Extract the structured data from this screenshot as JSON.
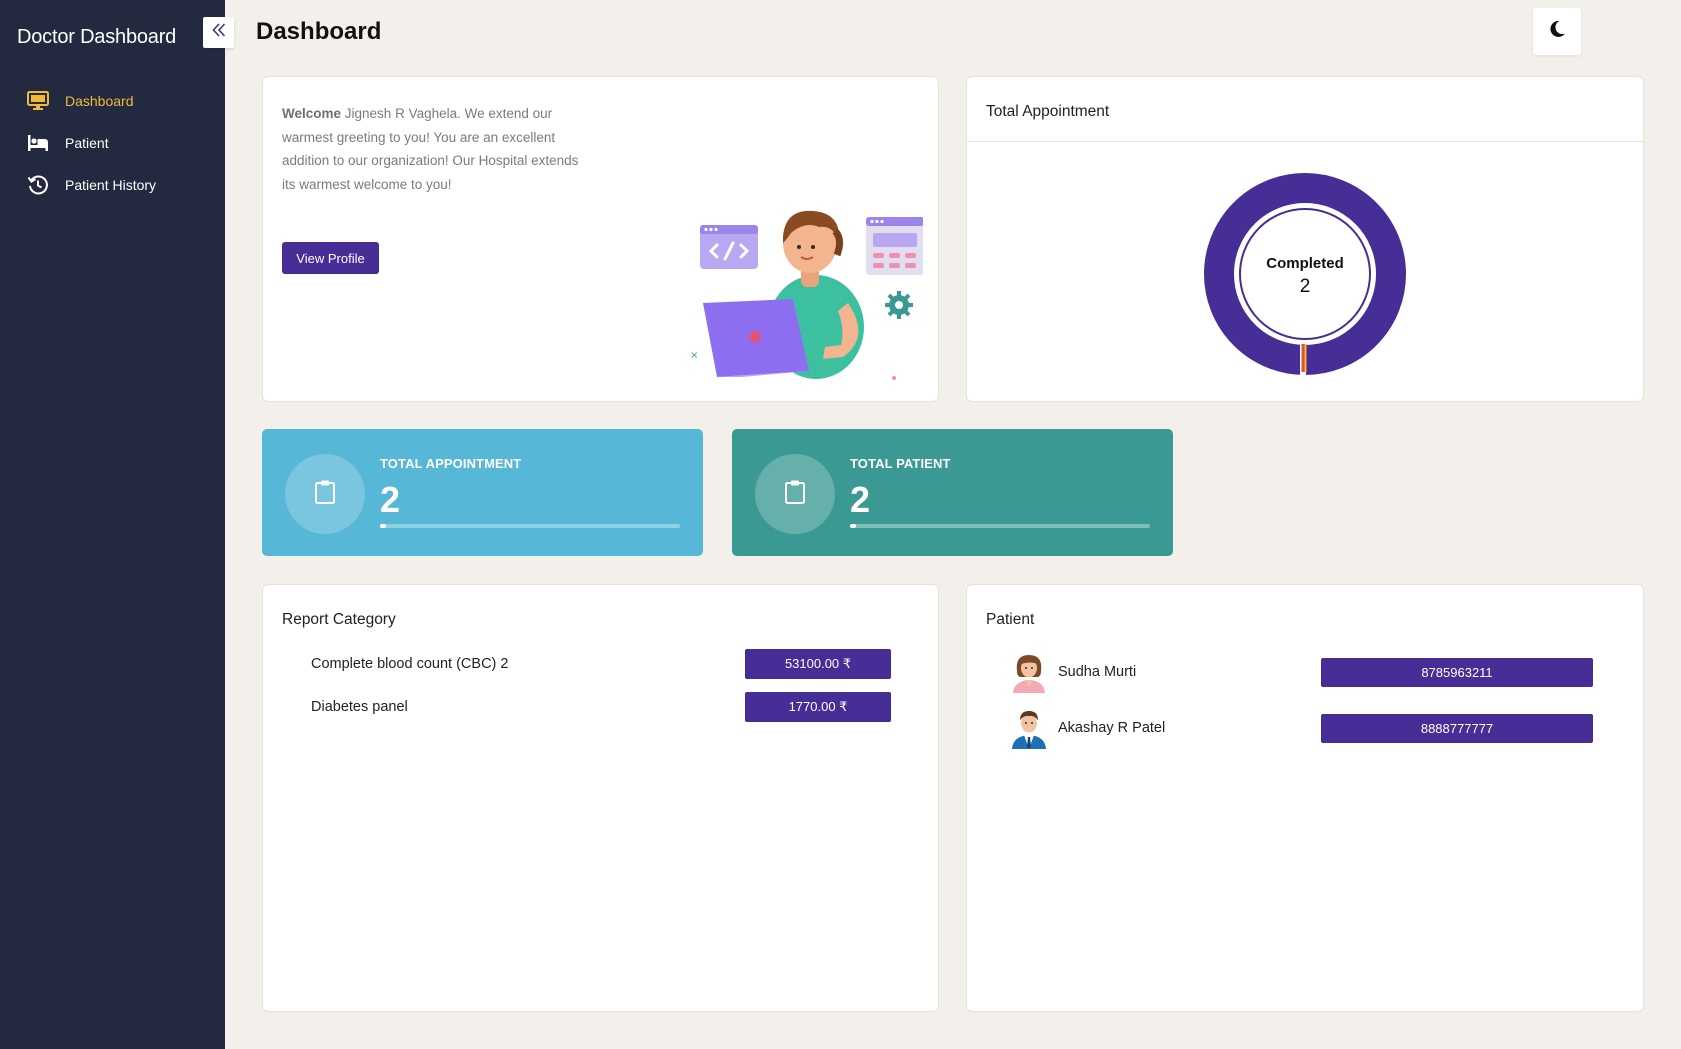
{
  "sidebar": {
    "brand": "Doctor Dashboard",
    "items": [
      {
        "label": "Dashboard",
        "icon": "monitor-icon",
        "active": true
      },
      {
        "label": "Patient",
        "icon": "bed-icon",
        "active": false
      },
      {
        "label": "Patient History",
        "icon": "history-icon",
        "active": false
      }
    ]
  },
  "header": {
    "title": "Dashboard",
    "theme_icon": "moon-icon"
  },
  "welcome": {
    "bold": "Welcome",
    "text": " Jignesh R Vaghela. We extend our warmest greeting to you! You are an excellent addition to our organization! Our Hospital extends its warmest welcome to you!",
    "button": "View Profile"
  },
  "appointment_chart": {
    "title": "Total Appointment",
    "center_label": "Completed",
    "center_value": "2"
  },
  "stats": [
    {
      "label": "TOTAL APPOINTMENT",
      "value": "2",
      "progress": 0.02,
      "color": "#57b7d6"
    },
    {
      "label": "TOTAL PATIENT",
      "value": "2",
      "progress": 0.02,
      "color": "#3a9a93"
    }
  ],
  "report": {
    "title": "Report Category",
    "rows": [
      {
        "name": "Complete blood count (CBC) 2",
        "price": "53100.00 ₹"
      },
      {
        "name": "Diabetes panel",
        "price": "1770.00 ₹"
      }
    ]
  },
  "patients": {
    "title": "Patient",
    "rows": [
      {
        "name": "Sudha Murti",
        "phone": "8785963211",
        "avatar": "female-avatar-icon"
      },
      {
        "name": "Akashay R Patel",
        "phone": "8888777777",
        "avatar": "male-avatar-icon"
      }
    ]
  },
  "colors": {
    "sidebar": "#232a40",
    "accent": "#462e96",
    "active_nav": "#f0b93b",
    "stat_blue": "#57b7d6",
    "stat_teal": "#3a9a93"
  }
}
